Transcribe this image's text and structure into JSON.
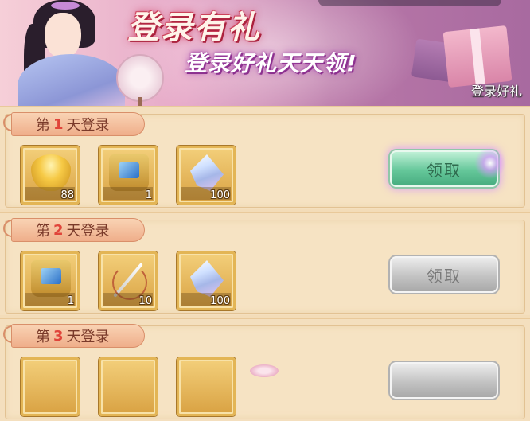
{
  "banner": {
    "title": "登录有礼",
    "subtitle": "登录好礼天天领!",
    "tag": "登录好礼"
  },
  "rows": [
    {
      "prefix": "第",
      "day": "1",
      "suffix": "天登录",
      "items": [
        {
          "icon": "gold-ingot-icon",
          "count": "88"
        },
        {
          "icon": "treasure-bag-icon",
          "count": "1"
        },
        {
          "icon": "crystal-icon",
          "count": "100"
        }
      ],
      "button": {
        "label": "领取",
        "state": "active"
      }
    },
    {
      "prefix": "第",
      "day": "2",
      "suffix": "天登录",
      "items": [
        {
          "icon": "treasure-bag-icon",
          "count": "1"
        },
        {
          "icon": "needle-thread-icon",
          "count": "10"
        },
        {
          "icon": "crystal-icon",
          "count": "100"
        }
      ],
      "button": {
        "label": "领取",
        "state": "disabled"
      }
    },
    {
      "prefix": "第",
      "day": "3",
      "suffix": "天登录",
      "items": [],
      "button": {
        "label": "",
        "state": "disabled"
      }
    }
  ],
  "colors": {
    "active_button": "#65c79a",
    "disabled_button": "#c3c3c3",
    "day_number": "#e0443a",
    "panel_bg": "#f6e3c3"
  }
}
